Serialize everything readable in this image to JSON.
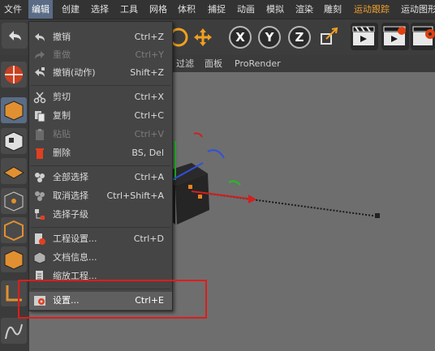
{
  "menubar": {
    "items": [
      {
        "label": "文件"
      },
      {
        "label": "编辑"
      },
      {
        "label": "创建"
      },
      {
        "label": "选择"
      },
      {
        "label": "工具"
      },
      {
        "label": "网格"
      },
      {
        "label": "体积"
      },
      {
        "label": "捕捉"
      },
      {
        "label": "动画"
      },
      {
        "label": "模拟"
      },
      {
        "label": "渲染"
      },
      {
        "label": "雕刻"
      },
      {
        "label": "运动跟踪"
      },
      {
        "label": "运动图形"
      }
    ]
  },
  "toolbar": {
    "axis_x": "X",
    "axis_y": "Y",
    "axis_z": "Z"
  },
  "viewport_menu": {
    "items": [
      {
        "label": "过滤"
      },
      {
        "label": "面板"
      },
      {
        "label": "ProRender"
      }
    ]
  },
  "edit_menu": {
    "items": [
      {
        "label": "撤销",
        "shortcut": "Ctrl+Z",
        "icon": "undo-icon",
        "enabled": true
      },
      {
        "label": "重做",
        "shortcut": "Ctrl+Y",
        "icon": "redo-icon",
        "enabled": false
      },
      {
        "label": "撤销(动作)",
        "shortcut": "Shift+Z",
        "icon": "undo-action-icon",
        "enabled": true
      },
      {
        "label": "剪切",
        "shortcut": "Ctrl+X",
        "icon": "scissors-icon",
        "enabled": true
      },
      {
        "label": "复制",
        "shortcut": "Ctrl+C",
        "icon": "copy-icon",
        "enabled": true
      },
      {
        "label": "粘贴",
        "shortcut": "Ctrl+V",
        "icon": "paste-icon",
        "enabled": false
      },
      {
        "label": "删除",
        "shortcut": "BS, Del",
        "icon": "trash-icon",
        "enabled": true
      },
      {
        "label": "全部选择",
        "shortcut": "Ctrl+A",
        "icon": "select-all-icon",
        "enabled": true
      },
      {
        "label": "取消选择",
        "shortcut": "Ctrl+Shift+A",
        "icon": "deselect-icon",
        "enabled": true
      },
      {
        "label": "选择子级",
        "shortcut": "",
        "icon": "select-children-icon",
        "enabled": true
      },
      {
        "label": "工程设置...",
        "shortcut": "Ctrl+D",
        "icon": "project-settings-icon",
        "enabled": true
      },
      {
        "label": "文档信息...",
        "shortcut": "",
        "icon": "document-info-icon",
        "enabled": true
      },
      {
        "label": "缩放工程...",
        "shortcut": "",
        "icon": "scale-project-icon",
        "enabled": true
      },
      {
        "label": "设置...",
        "shortcut": "Ctrl+E",
        "icon": "preferences-icon",
        "enabled": true,
        "highlighted": true
      }
    ]
  },
  "colors": {
    "accent_menu": "#5a6c86",
    "highlight_box": "#e01b1b",
    "tracking_menu": "#f0a030",
    "viewport_bg": "#6e6e6e"
  }
}
